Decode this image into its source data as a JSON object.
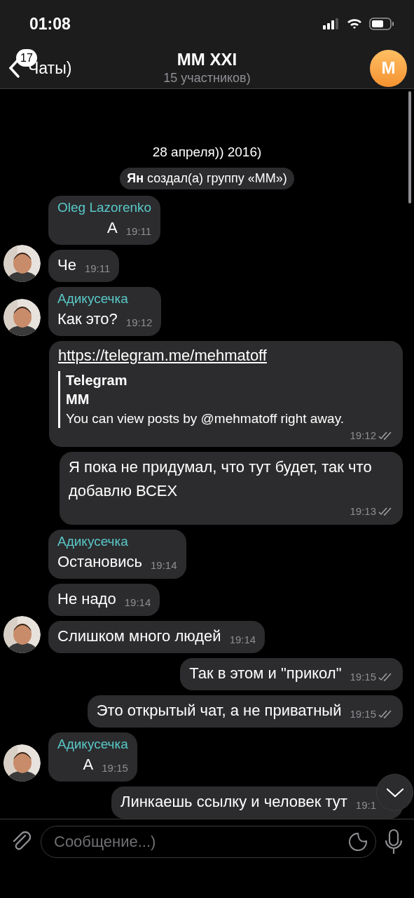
{
  "status_bar": {
    "time": "01:08"
  },
  "header": {
    "back_label": "Чаты)",
    "unread_badge": "17",
    "title": "MM XXI",
    "subtitle": "15 участников)",
    "avatar_letter": "M"
  },
  "date_label": "28 апреля)) 2016)",
  "service_message": "**Ян** создал(а) группу «ММ»)",
  "messages": [
    {
      "kind": "text",
      "outgoing": false,
      "sender": "Oleg Lazorenko",
      "text": "А",
      "time": "19:11",
      "avatar": false
    },
    {
      "kind": "text",
      "outgoing": false,
      "text": "Че",
      "time": "19:11",
      "avatar": true
    },
    {
      "kind": "text",
      "outgoing": false,
      "sender": "Адикусечка",
      "text": "Как это?",
      "time": "19:12",
      "avatar": true
    },
    {
      "kind": "link",
      "outgoing": true,
      "link": "https://telegram.me/mehmatoff",
      "preview_site": "Telegram",
      "preview_title": "MM",
      "preview_text": "You can view posts by @mehmatoff right away.",
      "time": "19:12",
      "read": true
    },
    {
      "kind": "text",
      "outgoing": true,
      "text": "Я пока не придумал, что тут будет, так что добавлю ВСЕХ",
      "time": "19:13",
      "read": true
    },
    {
      "kind": "text",
      "outgoing": false,
      "sender": "Адикусечка",
      "text": "Остановись",
      "time": "19:14",
      "avatar": false
    },
    {
      "kind": "text",
      "outgoing": false,
      "text": "Не надо",
      "time": "19:14",
      "avatar": false
    },
    {
      "kind": "text",
      "outgoing": false,
      "text": "Слишком много людей",
      "time": "19:14",
      "avatar": true
    },
    {
      "kind": "text",
      "outgoing": true,
      "text": "Так в этом и \"прикол\"",
      "time": "19:15",
      "read": true
    },
    {
      "kind": "text",
      "outgoing": true,
      "text": "Это открытый чат, а не приватный",
      "time": "19:15",
      "read": true
    },
    {
      "kind": "text",
      "outgoing": false,
      "sender": "Адикусечка",
      "text": "А",
      "time": "19:15",
      "avatar": true
    },
    {
      "kind": "text",
      "outgoing": true,
      "text": "Линкаешь ссылку и человек тут",
      "time": "19:1"
    }
  ],
  "composer": {
    "placeholder": "Сообщение...)"
  }
}
